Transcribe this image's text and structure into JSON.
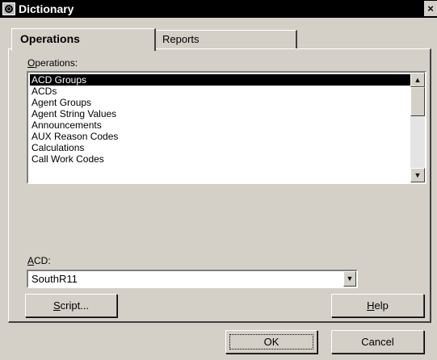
{
  "window": {
    "title": "Dictionary",
    "close_glyph": "×"
  },
  "tabs": [
    {
      "label": "Operations",
      "active": true
    },
    {
      "label": "Reports",
      "active": false
    }
  ],
  "operations": {
    "label": "Operations:",
    "items": [
      "ACD Groups",
      "ACDs",
      "Agent Groups",
      "Agent String Values",
      "Announcements",
      "AUX Reason Codes",
      "Calculations",
      "Call Work Codes"
    ],
    "selected": "ACD Groups"
  },
  "acd": {
    "label": "ACD:",
    "value": "SouthR11"
  },
  "buttons": {
    "script": "Script...",
    "help": "Help",
    "ok": "OK",
    "cancel": "Cancel"
  },
  "icons": {
    "scroll_up": "▲",
    "scroll_down": "▼",
    "dropdown": "▼"
  }
}
